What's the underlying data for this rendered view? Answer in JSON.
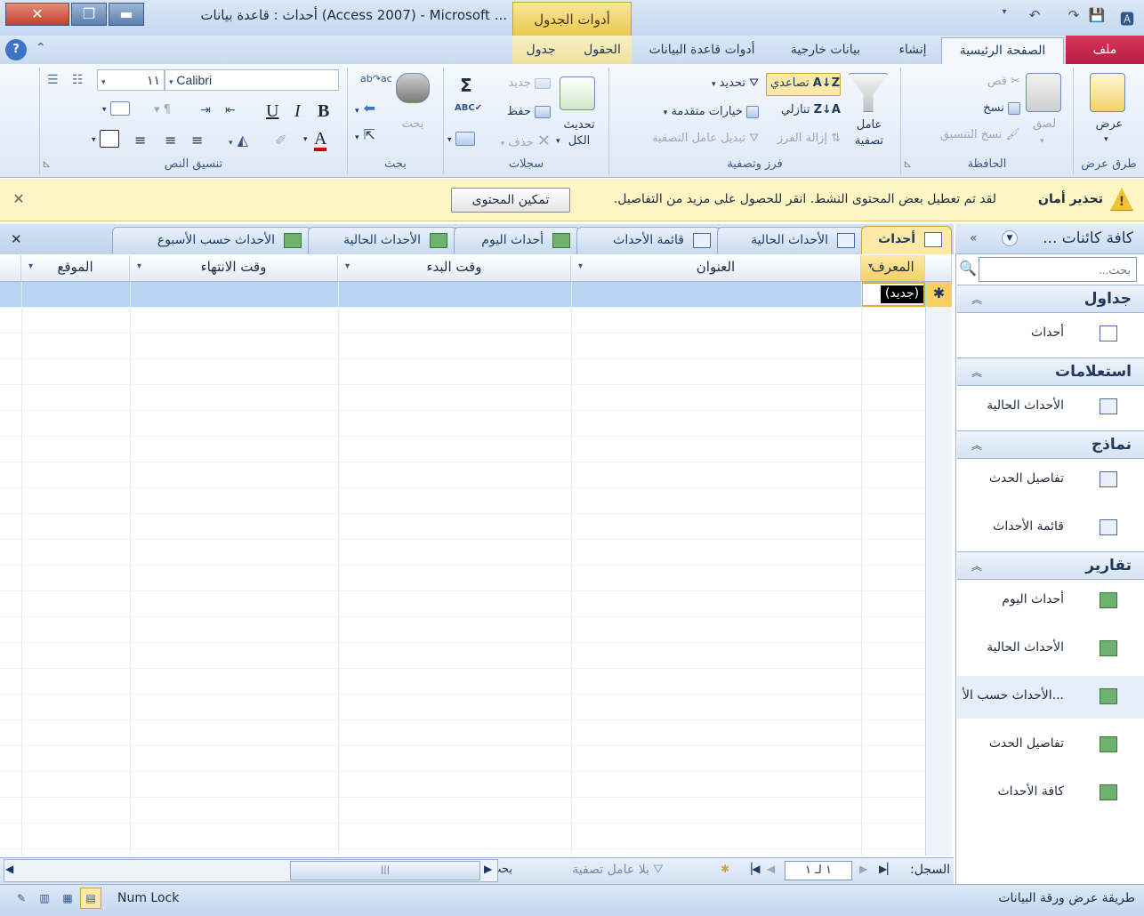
{
  "window": {
    "title": "أحداث : قاعدة بيانات (Access 2007) - Microsoft ...",
    "context_tab": "أدوات الجدول",
    "close": "✕",
    "restore": "❐",
    "minimize": "▬"
  },
  "ribbon_tabs": {
    "file": "ملف",
    "home": "الصفحة الرئيسية",
    "create": "إنشاء",
    "external": "بيانات خارجية",
    "dbtools": "أدوات قاعدة البيانات",
    "fields": "الحقول",
    "table": "جدول"
  },
  "groups": {
    "views": {
      "label": "طرق عرض",
      "view": "عرض"
    },
    "clipboard": {
      "label": "الحافظة",
      "paste": "لصق",
      "cut": "قص",
      "copy": "نسخ",
      "format_painter": "نسخ التنسيق"
    },
    "sort_filter": {
      "label": "فرز وتصفية",
      "filter": "عامل\nتصفية",
      "filter_l1": "عامل",
      "filter_l2": "تصفية",
      "ascending": "تصاعدي",
      "descending": "تنازلي",
      "remove_sort": "إزالة الفرز",
      "selection": "تحديد",
      "advanced": "خيارات متقدمة",
      "toggle_filter": "تبديل عامل التصفية"
    },
    "records": {
      "label": "سجلات",
      "refresh_l1": "تحديث",
      "refresh_l2": "الكل",
      "new": "جديد",
      "save": "حفظ",
      "delete": "حذف"
    },
    "find": {
      "label": "بحث",
      "find": "بحث"
    },
    "text_format": {
      "label": "تنسيق النص",
      "font": "Calibri",
      "size": "١١",
      "bold": "B",
      "italic": "I",
      "underline": "U",
      "font_color": "A"
    }
  },
  "security": {
    "title": "تحذير أمان",
    "message": "لقد تم تعطيل بعض المحتوى النشط. انقر للحصول على مزيد من التفاصيل.",
    "enable": "تمكين المحتوى"
  },
  "nav": {
    "title": "كافة كائنات ...",
    "search_placeholder": "بحث...",
    "sections": [
      {
        "label": "جداول",
        "items": [
          "أحداث"
        ]
      },
      {
        "label": "استعلامات",
        "items": [
          "الأحداث الحالية"
        ]
      },
      {
        "label": "نماذج",
        "items": [
          "تفاصيل الحدث",
          "قائمة الأحداث"
        ]
      },
      {
        "label": "تقارير",
        "items": [
          "أحداث اليوم",
          "الأحداث الحالية",
          "الأحداث حسب الأ...",
          "تفاصيل الحدث",
          "كافة الأحداث"
        ]
      }
    ]
  },
  "doc_tabs": [
    "أحداث",
    "الأحداث الحالية",
    "قائمة الأحداث",
    "أحداث اليوم",
    "الأحداث الحالية",
    "الأحداث حسب الأسبوع"
  ],
  "columns": [
    "المعرف",
    "العنوان",
    "وقت البدء",
    "وقت الانتهاء",
    "الموقع"
  ],
  "new_row": {
    "marker": "✱",
    "value": "(جديد)"
  },
  "record_nav": {
    "label": "السجل:",
    "position": "١ لـ ١",
    "no_filter": "بلا عامل تصفية",
    "search": "بحث"
  },
  "status": {
    "view": "طريقة عرض ورقة البيانات",
    "numlock": "Num Lock"
  }
}
